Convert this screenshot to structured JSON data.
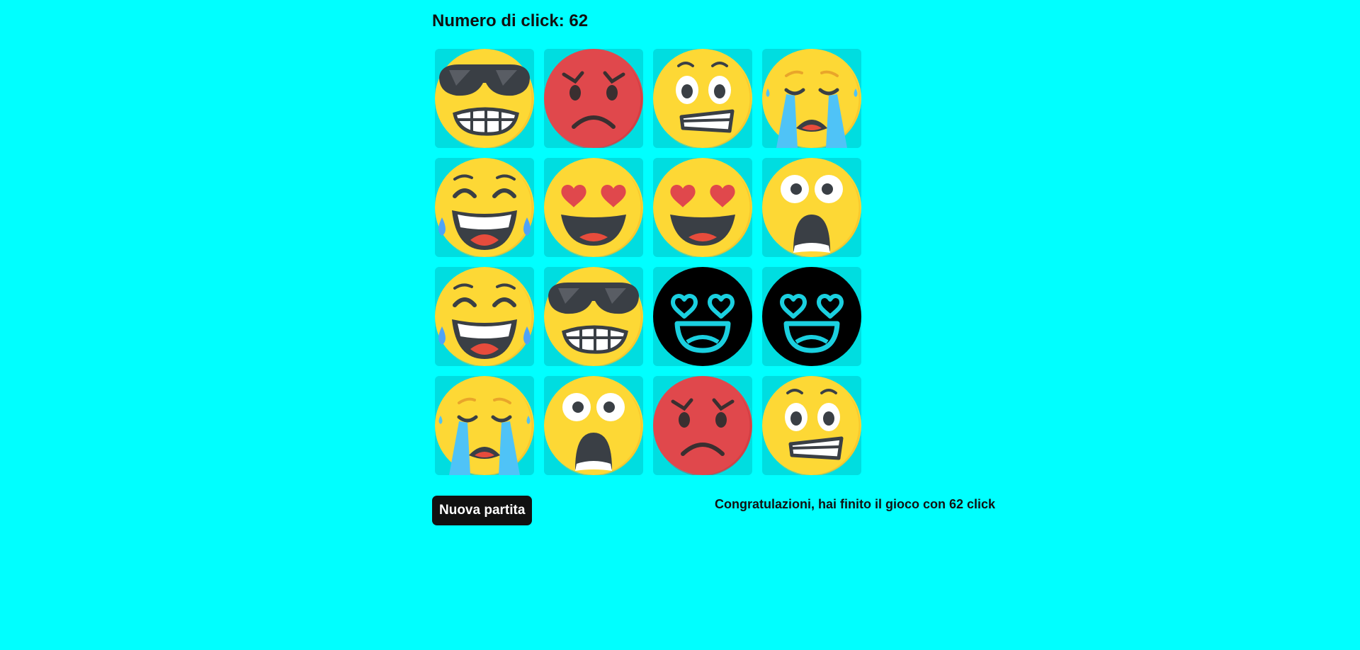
{
  "header": {
    "clicks_text": "Numero di click: 62"
  },
  "board": {
    "rows": 4,
    "columns": 4,
    "cards": [
      {
        "emoji": "cool-sunglasses-grimace",
        "status": "revealed"
      },
      {
        "emoji": "angry-red-face",
        "status": "revealed"
      },
      {
        "emoji": "anxious-grimace",
        "status": "revealed"
      },
      {
        "emoji": "crying-sad-face",
        "status": "revealed"
      },
      {
        "emoji": "laughing-tears-face",
        "status": "revealed"
      },
      {
        "emoji": "heart-eyes-face",
        "status": "revealed"
      },
      {
        "emoji": "heart-eyes-face",
        "status": "revealed"
      },
      {
        "emoji": "shocked-face",
        "status": "revealed"
      },
      {
        "emoji": "laughing-tears-face",
        "status": "revealed"
      },
      {
        "emoji": "cool-sunglasses-grimace",
        "status": "revealed"
      },
      {
        "emoji": "heart-eyes-outline-black",
        "status": "revealed"
      },
      {
        "emoji": "heart-eyes-outline-black",
        "status": "revealed"
      },
      {
        "emoji": "crying-sad-face",
        "status": "revealed"
      },
      {
        "emoji": "shocked-face",
        "status": "revealed"
      },
      {
        "emoji": "angry-red-face",
        "status": "revealed"
      },
      {
        "emoji": "anxious-grimace",
        "status": "revealed"
      }
    ]
  },
  "controls": {
    "new_game_label": "Nuova partita"
  },
  "status": {
    "message": "Congratulazioni, hai finito il gioco con 62 click"
  },
  "colors": {
    "background": "#00ffff",
    "card_background": "#00dde0",
    "button_background": "#111111",
    "button_text": "#ffffff",
    "emoji_yellow": "#fdd835",
    "emoji_red": "#e0484c",
    "emoji_black": "#000000",
    "outline_cyan": "#1ad0e0"
  }
}
